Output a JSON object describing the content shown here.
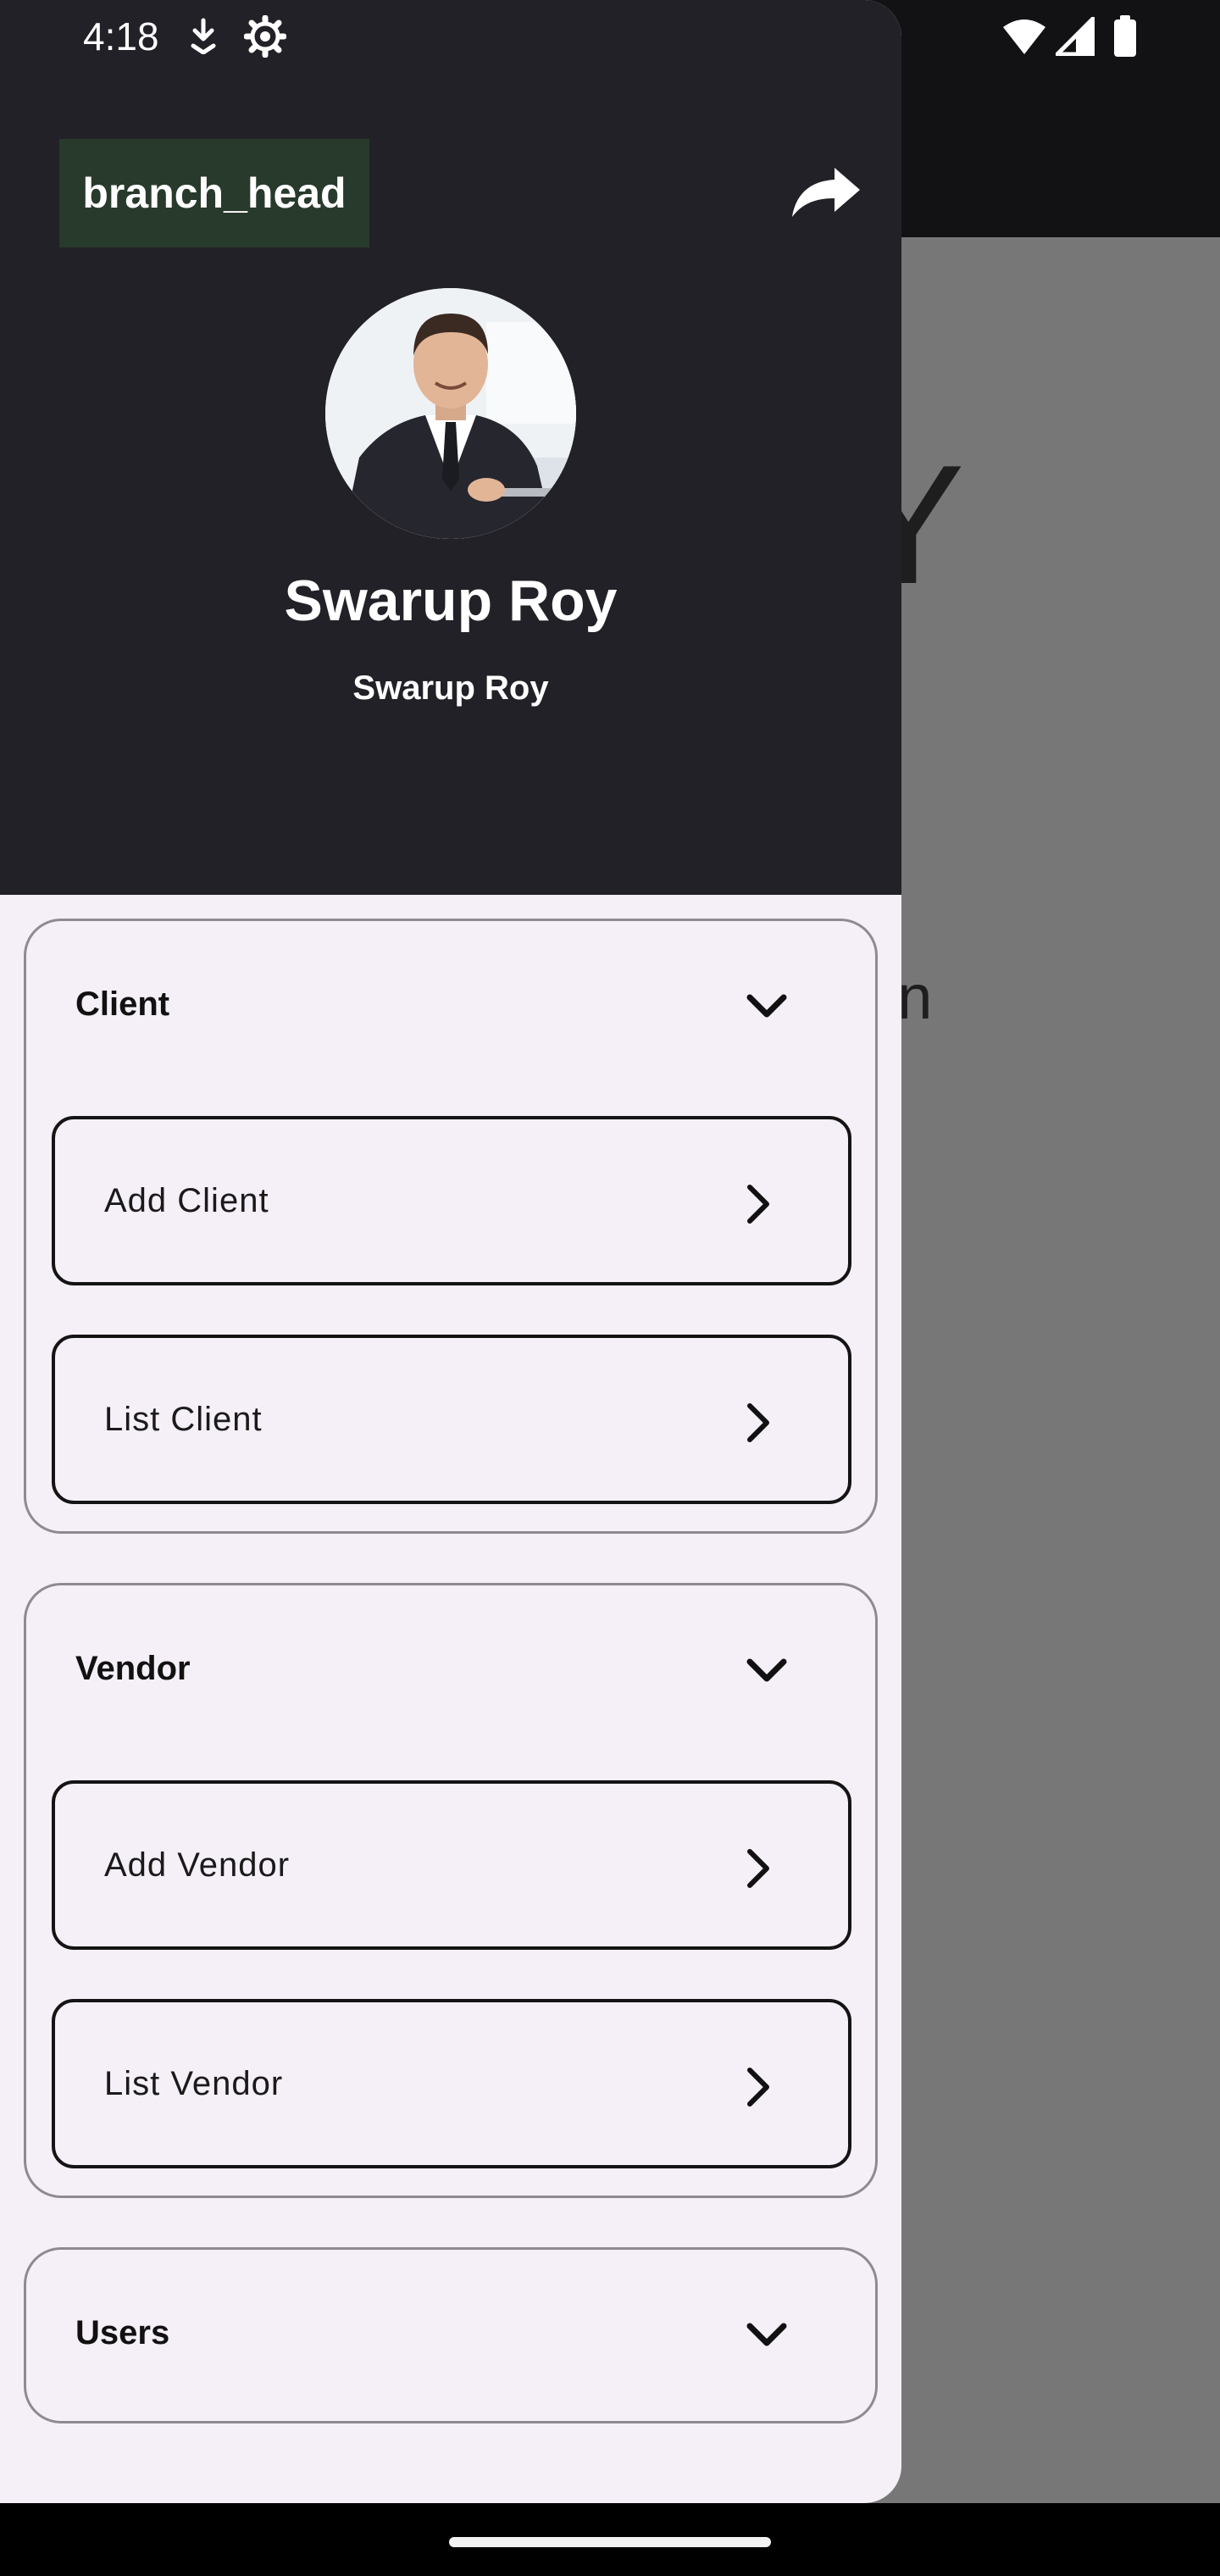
{
  "status_bar": {
    "time": "4:18",
    "icons": [
      "download-arrow-icon",
      "gear-icon",
      "wifi-icon",
      "cellular-signal-icon",
      "battery-icon"
    ]
  },
  "background": {
    "big_text": "BY",
    "sub_text": "uisition"
  },
  "drawer": {
    "role_badge": "branch_head",
    "share_icon": "share-icon",
    "profile": {
      "name": "Swarup Roy",
      "subtitle": "Swarup Roy"
    },
    "sections": [
      {
        "title": "Client",
        "items": [
          {
            "label": "Add Client"
          },
          {
            "label": "List Client"
          }
        ]
      },
      {
        "title": "Vendor",
        "items": [
          {
            "label": "Add Vendor"
          },
          {
            "label": "List Vendor"
          }
        ]
      },
      {
        "title": "Users",
        "items": []
      }
    ]
  },
  "colors": {
    "drawer_header_bg": "#222127",
    "role_badge_bg": "#283a2c",
    "drawer_bg": "#f5eff7",
    "scrim": "#777777"
  }
}
